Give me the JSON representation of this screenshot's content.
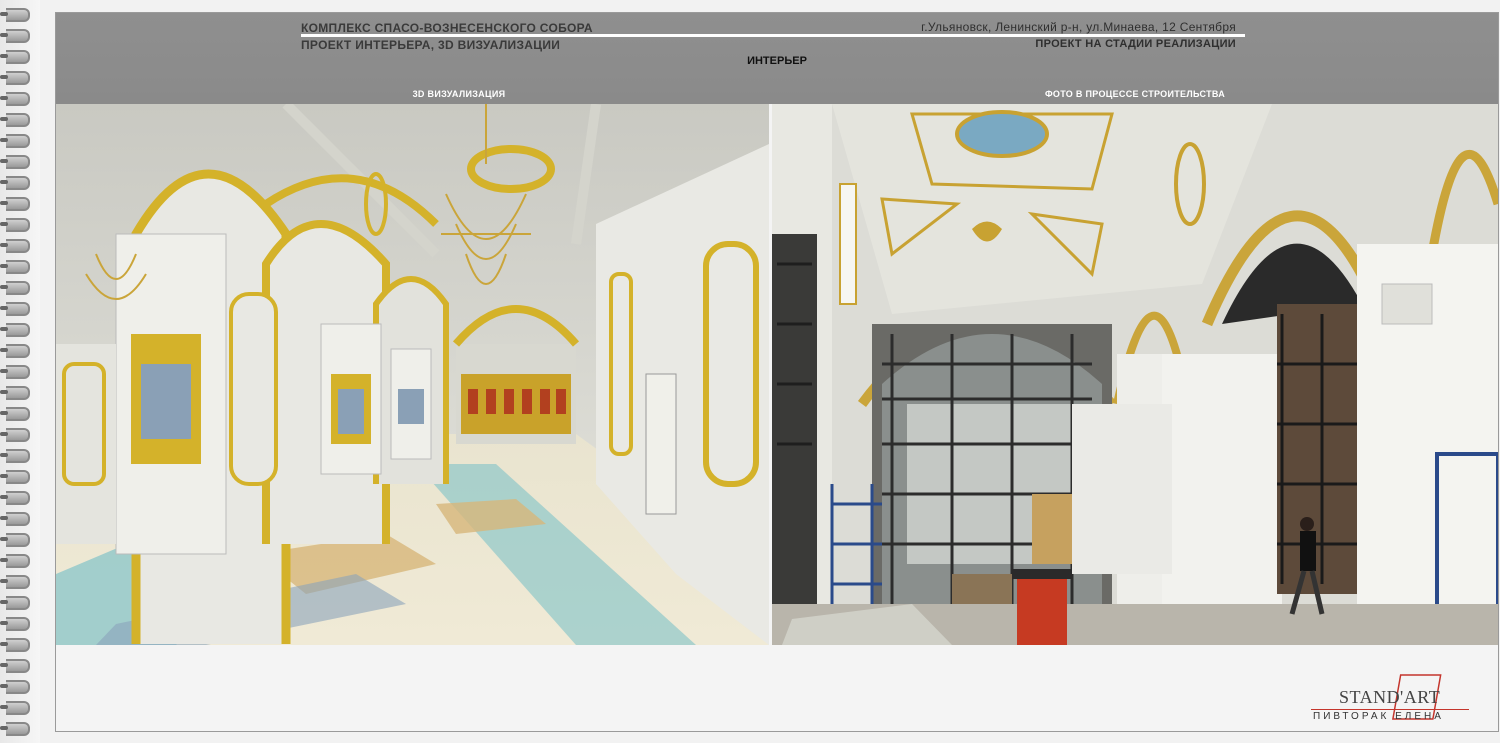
{
  "header": {
    "project_line1": "КОМПЛЕКС СПАСО-ВОЗНЕСЕНСКОГО СОБОРА",
    "project_line2": "ПРОЕКТ ИНТЕРЬЕРА, 3D ВИЗУАЛИЗАЦИИ",
    "address": "г.Ульяновск, Ленинский р-н, ул.Минаева, 12 Сентября",
    "status": "ПРОЕКТ НА СТАДИИ РЕАЛИЗАЦИИ",
    "section": "ИНТЕРЬЕР"
  },
  "panels": {
    "left_label": "3D ВИЗУАЛИЗАЦИЯ",
    "right_label": "ФОТО В ПРОЦЕССЕ СТРОИТЕЛЬСТВА"
  },
  "logo": {
    "brand": "STAND'ART",
    "name": "ПИВТОРАК ЕЛЕНА"
  },
  "colors": {
    "header_bg": "#8c8c8c",
    "gold": "#d4b22a",
    "wall": "#e8e8e3",
    "floor_blue": "#8fc7c9"
  }
}
